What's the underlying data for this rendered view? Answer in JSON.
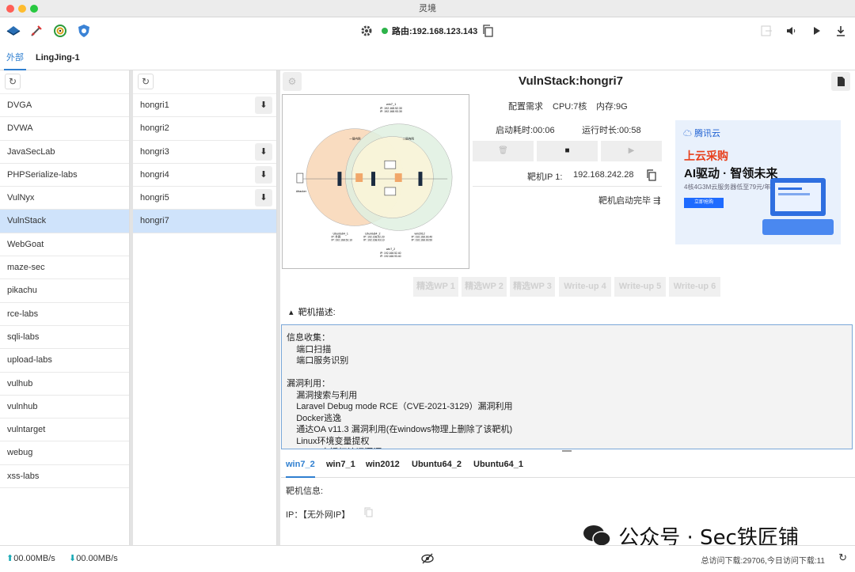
{
  "window": {
    "title": "灵境"
  },
  "toolbar": {
    "route_label": "路由:192.168.123.143"
  },
  "tabs": [
    {
      "label": "外部"
    },
    {
      "label": "LingJing-1"
    }
  ],
  "labs": [
    "DVGA",
    "DVWA",
    "JavaSecLab",
    "PHPSerialize-labs",
    "VulNyx",
    "VulnStack",
    "WebGoat",
    "maze-sec",
    "pikachu",
    "rce-labs",
    "sqli-labs",
    "upload-labs",
    "vulhub",
    "vulnhub",
    "vulntarget",
    "webug",
    "xss-labs"
  ],
  "targets": [
    "hongri1",
    "hongri2",
    "hongri3",
    "hongri4",
    "hongri5",
    "hongri7"
  ],
  "detail": {
    "title": "VulnStack:hongri7",
    "config_label": "配置需求",
    "cpu": "CPU:7核",
    "memory": "内存:9G",
    "boot_time": "启动耗时:00:06",
    "run_time": "运行时长:00:58",
    "target_ip_label": "靶机IP 1:",
    "target_ip": "192.168.242.28",
    "status": "靶机启动完毕",
    "wp_buttons": [
      "精选WP 1",
      "精选WP 2",
      "精选WP 3",
      "Write-up 4",
      "Write-up 5",
      "Write-up 6"
    ],
    "desc_header": "靶机描述:",
    "description": "信息收集：\n    端口扫描\n    端口服务识别\n\n漏洞利用：\n    漏洞搜索与利用\n    Laravel Debug mode RCE（CVE-2021-3129）漏洞利用\n    Docker逃逸\n    通达OA v11.3 漏洞利用(在windows物理上删除了该靶机)\n    Linux环境变量提权\n    Redis 未授权访问漏洞"
  },
  "ad": {
    "brand": "腾讯云",
    "line1": "上云采购",
    "line2": "AI驱动 · 智领未来",
    "line3": "4核4G3M云服务器低至79元/年",
    "button": "立即抢购"
  },
  "hosts": [
    "win7_2",
    "win7_1",
    "win2012",
    "Ubuntu64_2",
    "Ubuntu64_1"
  ],
  "host_info": {
    "header": "靶机信息:",
    "ip": "IP：【无外网IP】"
  },
  "diagram": {
    "hosts": [
      {
        "name": "win7_1",
        "lines": [
          "IP: 192.168.52.30",
          "IP: 192.168.93.30"
        ]
      },
      {
        "name": "Ubuntu64_1",
        "lines": [
          "IP: 外网",
          "IP: 192.168.52.10"
        ]
      },
      {
        "name": "Ubuntu64_2",
        "lines": [
          "IP: 192.168.52.20",
          "IP: 192.168.93.10"
        ]
      },
      {
        "name": "win2012",
        "lines": [
          "IP: 192.168.93.40",
          "IP: 192.168.93.50"
        ]
      },
      {
        "name": "win7_2",
        "lines": [
          "IP: 192.168.52.40",
          "IP: 192.168.93.40"
        ]
      }
    ],
    "zone_left": "一层内网",
    "zone_right": "二层内网",
    "attacker": "Attacker"
  },
  "status": {
    "up": "00.00MB/s",
    "down": "00.00MB/s",
    "visits": "总访问下载:29706,今日访问下载:11"
  },
  "watermark": "公众号 · Sec铁匠铺",
  "colors": {
    "accent": "#2f7fd0",
    "selected": "#cfe3fb",
    "online": "#2db34a"
  }
}
